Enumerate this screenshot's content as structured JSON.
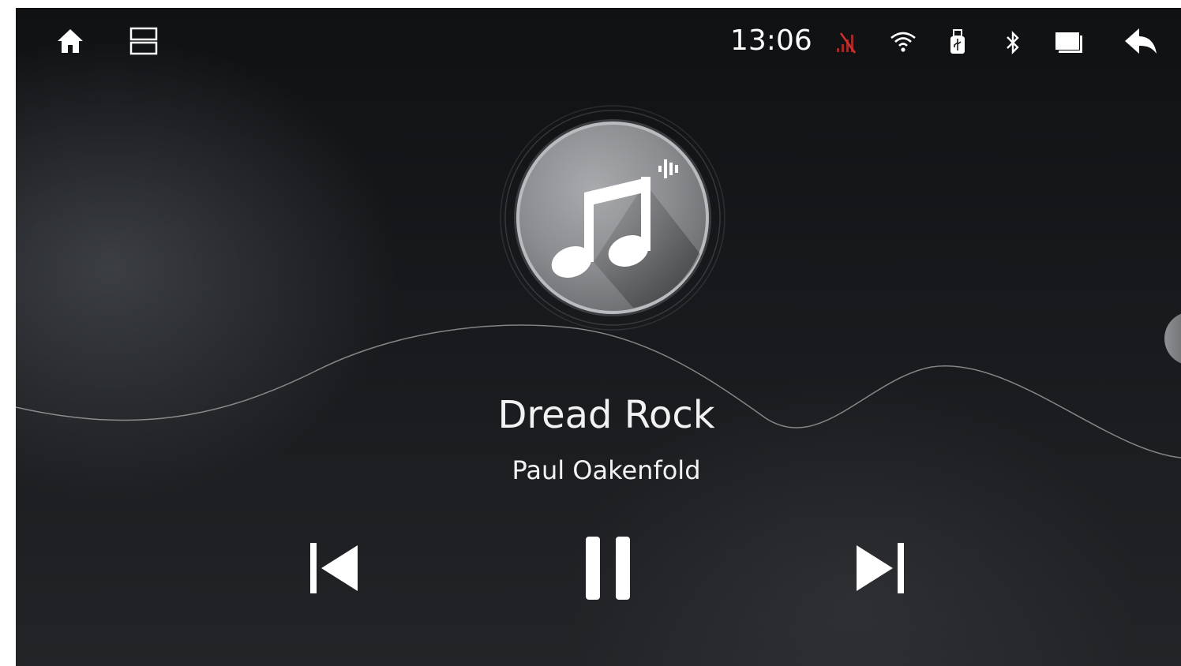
{
  "status_bar": {
    "time": "13:06",
    "icons": [
      "home-icon",
      "multi-window-icon",
      "no-signal-icon",
      "wifi-icon",
      "usb-icon",
      "bluetooth-icon",
      "screen-icon",
      "back-icon"
    ],
    "signal_color": "#c62828"
  },
  "player": {
    "title": "Dread Rock",
    "artist": "Paul Oakenfold",
    "state": "playing",
    "album_art_icon": "music-note-icon",
    "controls": [
      "previous-track-icon",
      "pause-icon",
      "next-track-icon"
    ]
  },
  "colors": {
    "background": "#15171a",
    "text": "#f2f2f2"
  }
}
